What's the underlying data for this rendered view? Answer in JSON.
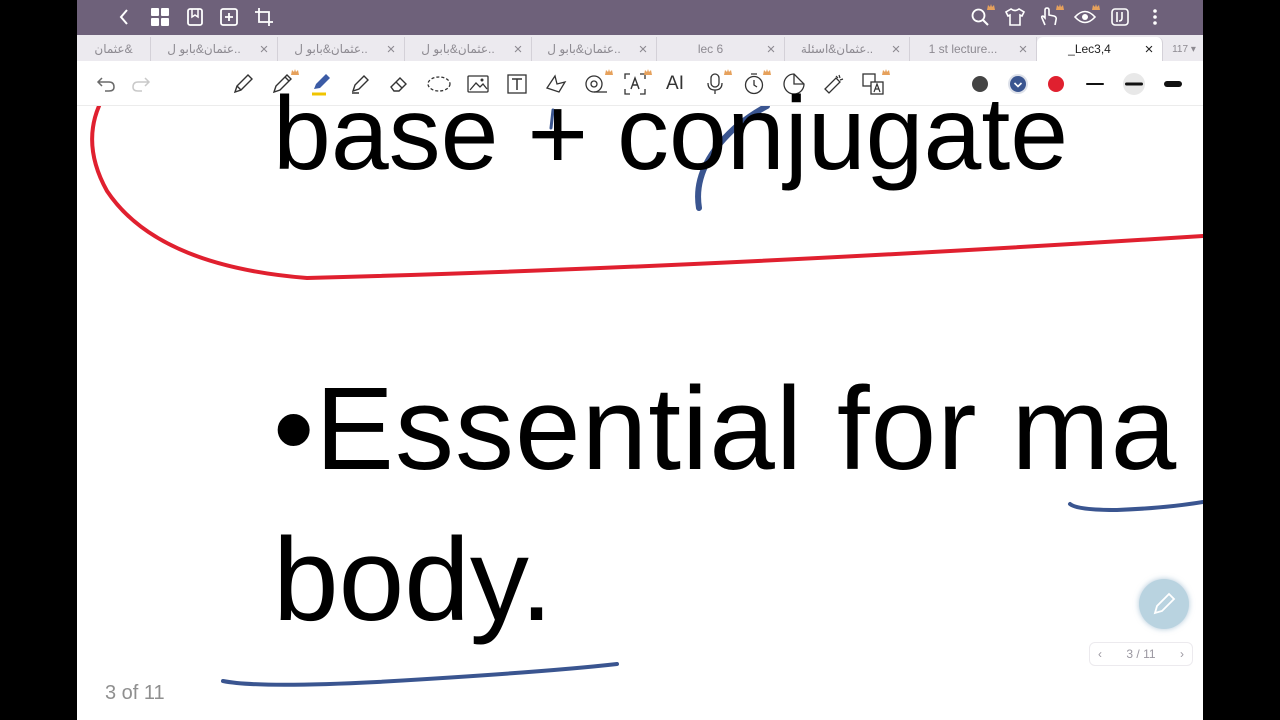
{
  "tabs": [
    {
      "label": "عثمان&",
      "active": false
    },
    {
      "label": "عثمان&بابو ل..",
      "active": false
    },
    {
      "label": "عثمان&بابو ل..",
      "active": false
    },
    {
      "label": "عثمان&بابو ل..",
      "active": false
    },
    {
      "label": "عثمان&بابو ل..",
      "active": false
    },
    {
      "label": "lec 6",
      "active": false
    },
    {
      "label": "عثمان&اسئلة..",
      "active": false
    },
    {
      "label": "1 st lecture...",
      "active": false
    },
    {
      "label": "_Lec3,4",
      "active": true
    }
  ],
  "tab_count": "117",
  "toolbar": {
    "ai_label": "AI"
  },
  "colors": {
    "topbar": "#6e617a",
    "pen_red": "#e0202f",
    "pen_blue": "#3a5590",
    "crown": "#e6a15c"
  },
  "content": {
    "line1": "base + conjugate",
    "line2": "•Essential for ma",
    "line3": "body."
  },
  "page_counter": "3 of 11",
  "pager": {
    "label": "3 / 11"
  }
}
